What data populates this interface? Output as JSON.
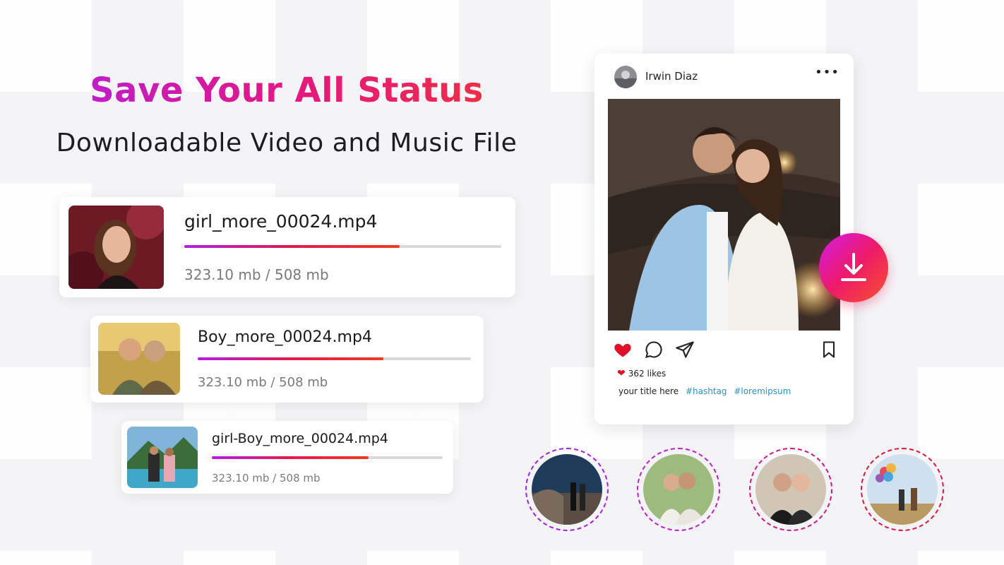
{
  "hero": {
    "headline": "Save Your All Status",
    "subheadline": "Downloadable Video and Music File"
  },
  "downloads": [
    {
      "file_name": "girl_more_00024.mp4",
      "size_text": "323.10 mb / 508 mb",
      "progress": 0.68
    },
    {
      "file_name": "Boy_more_00024.mp4",
      "size_text": "323.10 mb / 508 mb",
      "progress": 0.68
    },
    {
      "file_name": "girl-Boy_more_00024.mp4",
      "size_text": "323.10 mb / 508 mb",
      "progress": 0.68
    }
  ],
  "post": {
    "username": "Irwin Diaz",
    "more_label": "•••",
    "likes_text": "362 likes",
    "caption_text": "your title here",
    "hashtags": [
      "#hashtag",
      "#loremipsum"
    ]
  },
  "icons": {
    "like": "heart-icon",
    "comment": "comment-icon",
    "share": "send-icon",
    "save": "bookmark-icon",
    "download": "download-icon"
  },
  "colors": {
    "gradient_start": "#b21fe8",
    "gradient_mid": "#e6187a",
    "gradient_end": "#f23a2c",
    "like_red": "#e0102a",
    "hashtag_blue": "#2a93c9"
  }
}
